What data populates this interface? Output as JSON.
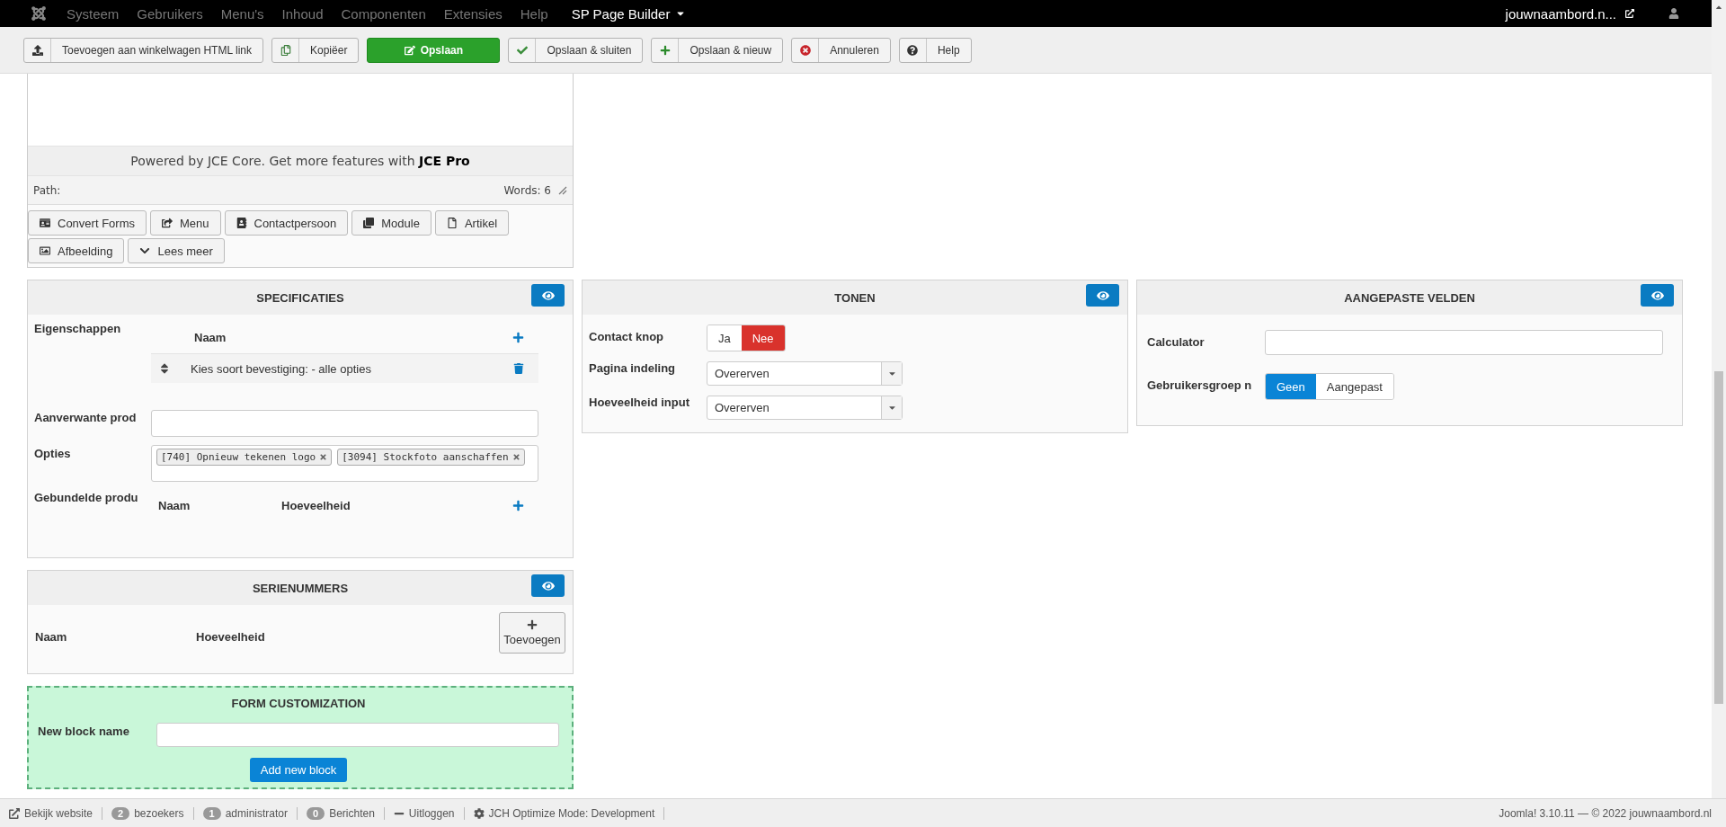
{
  "topbar": {
    "menu": [
      "Systeem",
      "Gebruikers",
      "Menu's",
      "Inhoud",
      "Componenten",
      "Extensies",
      "Help"
    ],
    "builder": "SP Page Builder",
    "site": "jouwnaambord.n..."
  },
  "toolbar": [
    {
      "label": "Toevoegen aan winkelwagen HTML link",
      "kind": "default"
    },
    {
      "label": "Kopiëer",
      "kind": "default"
    },
    {
      "label": "Opslaan",
      "kind": "primary"
    },
    {
      "label": "Opslaan & sluiten",
      "kind": "default"
    },
    {
      "label": "Opslaan & nieuw",
      "kind": "default"
    },
    {
      "label": "Annuleren",
      "kind": "default"
    },
    {
      "label": "Help",
      "kind": "default"
    }
  ],
  "editor": {
    "notice": "Powered by JCE Core. Get more features with **JCE Pro**",
    "path": "Path:",
    "words": "Words: 6",
    "buttons": [
      "Convert Forms",
      "Menu",
      "Contactpersoon",
      "Module",
      "Artikel",
      "Afbeelding",
      "Lees meer"
    ]
  },
  "specificaties": {
    "title": "SPECIFICATIES",
    "properties_label": "Eigenschappen",
    "properties_column": "Naam",
    "properties": [
      "Kies soort bevestiging: - alle opties"
    ],
    "related_label": "Aanverwante prod",
    "options_label": "Opties",
    "option_tags": [
      "[740] Opnieuw tekenen logo",
      "[3094] Stockfoto aanschaffen"
    ],
    "bundled_label": "Gebundelde produ",
    "bundled_columns": [
      "Naam",
      "Hoeveelheid"
    ]
  },
  "tonen": {
    "title": "TONEN",
    "fields": [
      {
        "label": "Contact knop",
        "kind": "toggle",
        "options": [
          {
            "label": "Ja",
            "selected": false
          },
          {
            "label": "Nee",
            "selected": true
          }
        ]
      },
      {
        "label": "Pagina indeling",
        "kind": "select",
        "value": "Overerven"
      },
      {
        "label": "Hoeveelheid input",
        "kind": "select",
        "value": "Overerven"
      }
    ]
  },
  "aangepaste_velden": {
    "title": "AANGEPASTE VELDEN",
    "fields": [
      {
        "label": "Calculator",
        "kind": "text"
      },
      {
        "label": "Gebruikersgroep n",
        "kind": "choice",
        "options": [
          {
            "label": "Geen",
            "selected": true
          },
          {
            "label": "Aangepast",
            "selected": false
          }
        ]
      }
    ]
  },
  "serienummers": {
    "title": "SERIENUMMERS",
    "columns": [
      "Naam",
      "Hoeveelheid"
    ],
    "add_button": "Toevoegen"
  },
  "form_customization": {
    "title": "FORM CUSTOMIZATION",
    "field_label": "New block name",
    "button": "Add new block"
  },
  "status_bar": {
    "items": [
      {
        "label": "Bekijk website"
      },
      {
        "count": "2",
        "label": "bezoekers"
      },
      {
        "count": "1",
        "label": "administrator"
      },
      {
        "count": "0",
        "label": "Berichten"
      },
      {
        "label": "Uitloggen"
      },
      {
        "label": "JCH Optimize Mode: Development"
      }
    ],
    "version": "Joomla! 3.10.11 — © 2022 jouwnaambord.nl"
  }
}
